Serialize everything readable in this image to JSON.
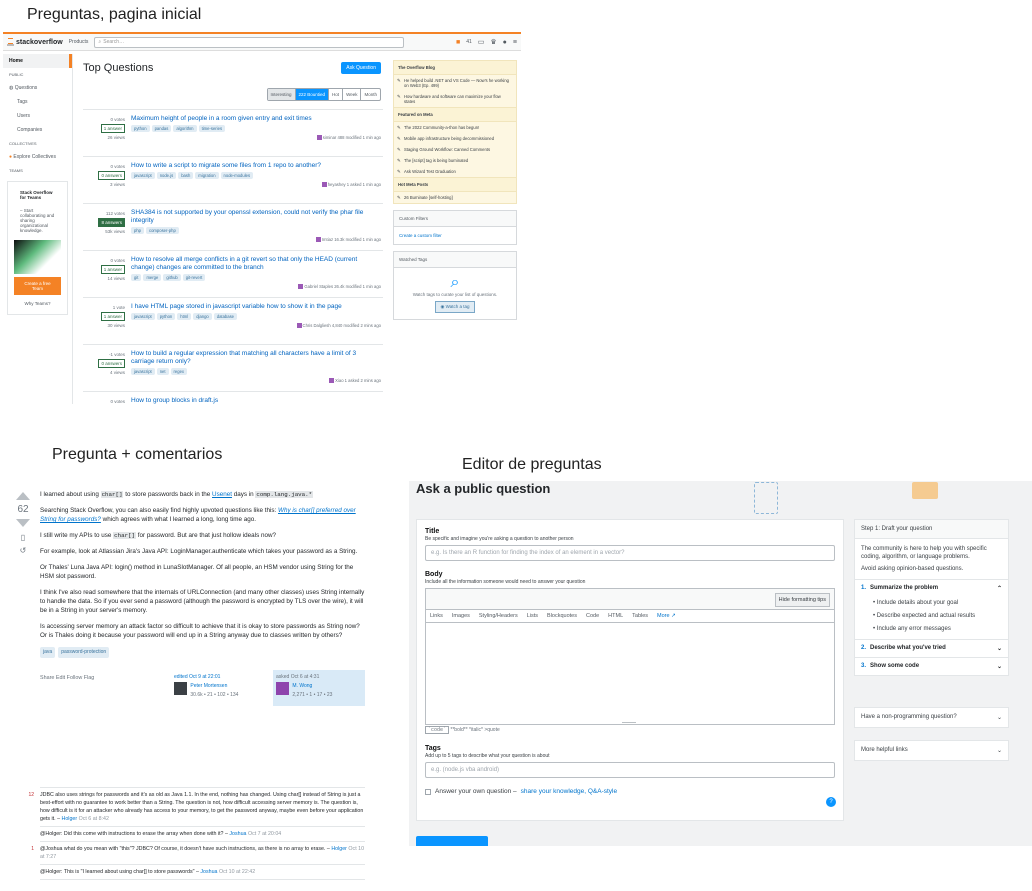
{
  "captions": {
    "home": "Preguntas, pagina inicial",
    "question": "Pregunta +  comentarios",
    "editor": "Editor de preguntas"
  },
  "home": {
    "logo": "stackoverflow",
    "products": "Products",
    "search_placeholder": "Search…",
    "rep": "41",
    "nav": {
      "home": "Home",
      "public": "PUBLIC",
      "questions": "Questions",
      "tags": "Tags",
      "users": "Users",
      "companies": "Companies",
      "collectives": "COLLECTIVES",
      "explore": "Explore Collectives",
      "teams": "TEAMS"
    },
    "teams_box": {
      "title": "Stack Overflow for Teams",
      "text": "– Start collaborating and sharing organizational knowledge.",
      "button": "Create a free Team",
      "why": "Why Teams?"
    },
    "page_title": "Top Questions",
    "ask_button": "Ask Question",
    "filters": [
      "Interesting",
      "222 Bountied",
      "Hot",
      "Week",
      "Month"
    ],
    "questions": [
      {
        "votes": "0 votes",
        "answers": "1 answer",
        "views": "26 views",
        "accepted": false,
        "title": "Maximum height of people in a room given entry and exit times",
        "tags": [
          "python",
          "pandas",
          "algorithm",
          "time-series"
        ],
        "user": "siminar 488 modified 1 min ago"
      },
      {
        "votes": "0 votes",
        "answers": "0 answers",
        "views": "3 views",
        "accepted": false,
        "title": "How to write a script to migrate some files from 1 repo to another?",
        "tags": [
          "javascript",
          "node.js",
          "bash",
          "migration",
          "node-modules"
        ],
        "user": "heyashey 1 asked 1 min ago"
      },
      {
        "votes": "112 votes",
        "answers": "8 answers",
        "views": "53k views",
        "accepted": true,
        "title": "SHA384 is not supported by your openssl extension, could not verify the phar file integrity",
        "tags": [
          "php",
          "composer-php"
        ],
        "user": "Imtiaz 16.3k modified 1 min ago"
      },
      {
        "votes": "0 votes",
        "answers": "1 answer",
        "views": "14 views",
        "accepted": false,
        "title": "How to resolve all merge conflicts in a git revert so that only the HEAD (current change) changes are committed to the branch",
        "tags": [
          "git",
          "merge",
          "github",
          "git-revert"
        ],
        "user": "Gabriel Staples 26.4k modified 1 min ago"
      },
      {
        "votes": "1 vote",
        "answers": "1 answer",
        "views": "30 views",
        "accepted": false,
        "title": "I have HTML page stored in javascript variable how to show it in the page",
        "tags": [
          "javascript",
          "python",
          "html",
          "django",
          "database"
        ],
        "user": "Chris Dalgliesh 4,840 modified 2 mins ago"
      },
      {
        "votes": "-1 votes",
        "answers": "0 answers",
        "views": "4 views",
        "accepted": false,
        "title": "How to build a regular expression that matching all characters have a limit of 3 carriage return only?",
        "tags": [
          "javascript",
          "net",
          "regex"
        ],
        "user": "Xiao 1 asked 2 mins ago"
      },
      {
        "votes": "0 votes",
        "answers": "",
        "views": "",
        "accepted": false,
        "title": "How to group blocks in draft.js",
        "tags": [],
        "user": ""
      }
    ],
    "blog": {
      "header": "The Overflow Blog",
      "items": [
        "He helped build .NET and VS Code — Now's he working on Web3 (Ep. 499)",
        "How hardware and software can maximize your flow states"
      ],
      "meta_header": "Featured on Meta",
      "meta_items": [
        "The 2022 Community-a-thon has begun!",
        "Mobile app infrastructure being decommissioned",
        "Staging Ground Workflow: Canned Comments",
        "The [script] tag is being burninated",
        "Ask Wizard Test Graduation"
      ],
      "hot_header": "Hot Meta Posts",
      "hot_items": [
        "26 Burninate [self-hosting]"
      ]
    },
    "custom_filters": {
      "header": "Custom Filters",
      "link": "Create a custom filter"
    },
    "watched": {
      "header": "Watched Tags",
      "text": "Watch tags to curate your list of questions.",
      "button": "Watch a tag"
    }
  },
  "question": {
    "score": "62",
    "p1_a": "I learned about using",
    "p1_code": "char[]",
    "p1_b": "to store passwords back in the",
    "p1_link": "Usenet",
    "p1_c": "days in",
    "p1_code2": "comp.lang.java.*",
    "p2": "Searching Stack Overflow, you can also easily find highly upvoted questions like this:",
    "p2_link": "Why is char[] preferred over String for passwords?",
    "p2_b": "which agrees with what I learned a long, long time ago.",
    "p3_a": "I still write my APIs to use",
    "p3_code": "char[]",
    "p3_b": "for password. But are that just hollow ideals now?",
    "p4": "For example, look at Atlassian Jira's Java API: LoginManager.authenticate which takes your password as a String.",
    "p5": "Or Thales' Luna Java API: login() method in LunaSlotManager. Of all people, an HSM vendor using String for the HSM slot password.",
    "p6": "I think I've also read somewhere that the internals of URLConnection (and many other classes) uses String internally to handle the data. So if you ever send a password (although the password is encrypted by TLS over the wire), it will be in a String in your server's memory.",
    "p7": "Is accessing server memory an attack factor so difficult to achieve that it is okay to store passwords as String now? Or is Thales doing it because your password will end up in a String anyway due to classes written by others?",
    "tags": [
      "java",
      "password-protection"
    ],
    "actions": "Share  Edit  Follow  Flag",
    "edited": {
      "when": "edited Oct 9 at 22:01",
      "name": "Peter Mortensen",
      "rep": "30.6k • 21 • 102 • 134"
    },
    "asked": {
      "when": "asked Oct 6 at 4:31",
      "name": "M. Wong",
      "rep": "2,271 • 1 • 17 • 23"
    },
    "comments": [
      {
        "score": "12",
        "text": "JDBC also uses strings for passwords and it's as old as Java 1.1. In the end, nothing has changed. Using char[] instead of String is just a best-effort with no guarantee to work better than a String. The question is not, how difficult accessing server memory is. The question is, how difficult is it for an attacker who already has access to your memory, to get the password anyway, maybe even before your application gets it.",
        "user": "Holger",
        "time": "Oct 6 at 8:42"
      },
      {
        "score": "",
        "text": "@Holger: Did this come with instructions to erase the array when done with it?",
        "user": "Joshua",
        "time": "Oct 7 at 20:04"
      },
      {
        "score": "1",
        "text": "@Joshua what do you mean with \"this\"? JDBC? Of course, it doesn't have such instructions, as there is no array to erase.",
        "user": "Holger",
        "time": "Oct 10 at 7:27"
      },
      {
        "score": "",
        "text": "@Holger: This is \"I learned about using char[] to store passwords\"",
        "user": "Joshua",
        "time": "Oct 10 at 22:42"
      }
    ]
  },
  "editor": {
    "title": "Ask a public question",
    "title_label": "Title",
    "title_sub": "Be specific and imagine you're asking a question to another person",
    "title_placeholder": "e.g. Is there an R function for finding the index of an element in a vector?",
    "body_label": "Body",
    "body_sub": "Include all the information someone would need to answer your question",
    "hide_tips": "Hide formatting tips",
    "toolbar": [
      "Links",
      "Images",
      "Styling/Headers",
      "Lists",
      "Blockquotes",
      "Code",
      "HTML",
      "Tables"
    ],
    "more": "More",
    "fmt_code": "`code`",
    "fmt_hint": "**bold**  *italic*  >quote",
    "tags_label": "Tags",
    "tags_sub": "Add up to 5 tags to describe what your question is about",
    "tags_placeholder": "e.g. (node.js vba android)",
    "own_answer": "Answer your own question –",
    "own_answer_link": "share your knowledge, Q&A-style",
    "step_header": "Step 1: Draft your question",
    "step_body": "The community is here to help you with specific coding, algorithm, or language problems.",
    "step_avoid": "Avoid asking opinion-based questions.",
    "steps": [
      {
        "n": "1.",
        "label": "Summarize the problem",
        "items": [
          "Include details about your goal",
          "Describe expected and actual results",
          "Include any error messages"
        ]
      },
      {
        "n": "2.",
        "label": "Describe what you've tried"
      },
      {
        "n": "3.",
        "label": "Show some code"
      }
    ],
    "nonprog": "Have a non-programming question?",
    "helpful": "More helpful links"
  }
}
